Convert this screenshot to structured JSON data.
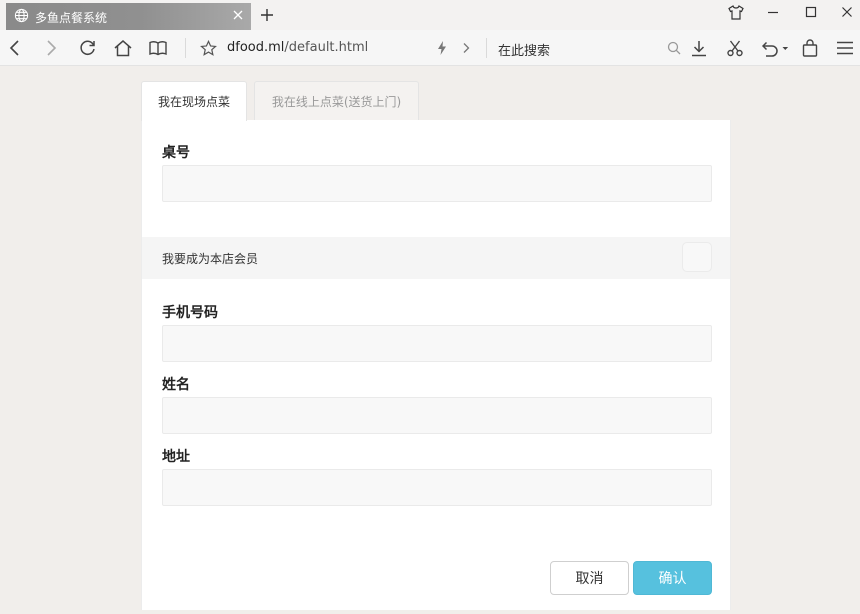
{
  "browser": {
    "tab_title": "多鱼点餐系统",
    "url_domain": "dfood.ml",
    "url_path": "/default.html",
    "search_placeholder": "在此搜索"
  },
  "tabs": [
    {
      "label": "我在现场点菜",
      "active": true
    },
    {
      "label": "我在线上点菜(送货上门)",
      "active": false
    }
  ],
  "form": {
    "table_label": "桌号",
    "table_value": "",
    "member_label": "我要成为本店会员",
    "member_checked": false,
    "phone_label": "手机号码",
    "phone_value": "",
    "name_label": "姓名",
    "name_value": "",
    "address_label": "地址",
    "address_value": ""
  },
  "buttons": {
    "cancel": "取消",
    "confirm": "确认"
  },
  "colors": {
    "accent": "#56c1de",
    "page_bg": "#f1eeeb"
  }
}
